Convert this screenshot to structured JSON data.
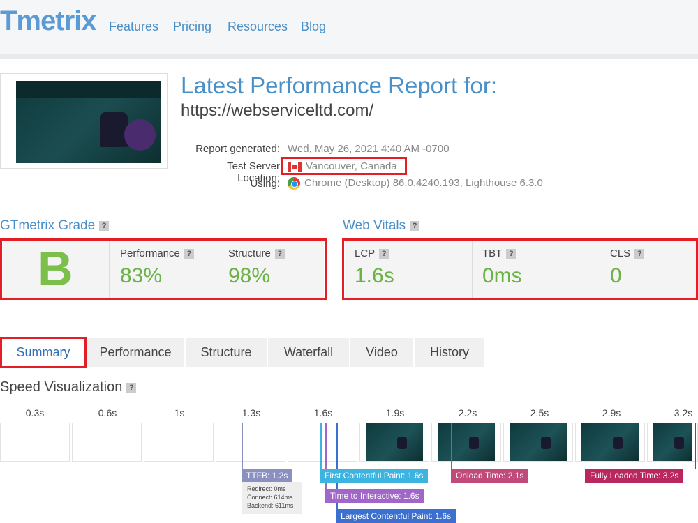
{
  "nav": {
    "logo": "Tmetrix",
    "links": [
      "Features",
      "Pricing",
      "Resources",
      "Blog"
    ]
  },
  "report": {
    "title": "Latest Performance Report for:",
    "url": "https://webserviceltd.com/",
    "generated_label": "Report generated:",
    "generated_value": "Wed, May 26, 2021 4:40 AM -0700",
    "server_label": "Test Server Location:",
    "server_value": "Vancouver, Canada",
    "using_label": "Using:",
    "using_value": "Chrome (Desktop) 86.0.4240.193, Lighthouse 6.3.0"
  },
  "grade": {
    "title": "GTmetrix Grade",
    "letter": "B",
    "performance_label": "Performance",
    "performance_value": "83%",
    "structure_label": "Structure",
    "structure_value": "98%"
  },
  "vitals": {
    "title": "Web Vitals",
    "lcp_label": "LCP",
    "lcp_value": "1.6s",
    "tbt_label": "TBT",
    "tbt_value": "0ms",
    "cls_label": "CLS",
    "cls_value": "0"
  },
  "tabs": [
    "Summary",
    "Performance",
    "Structure",
    "Waterfall",
    "Video",
    "History"
  ],
  "speed": {
    "title": "Speed Visualization",
    "ticks": [
      "0.3s",
      "0.6s",
      "1s",
      "1.3s",
      "1.6s",
      "1.9s",
      "2.2s",
      "2.5s",
      "2.9s",
      "3.2s"
    ],
    "markers": {
      "ttfb": "TTFB: 1.2s",
      "redirect": "Redirect: 0ms",
      "connect": "Connect: 614ms",
      "backend": "Backend: 611ms",
      "fcp": "First Contentful Paint: 1.6s",
      "tti": "Time to Interactive: 1.6s",
      "lcp": "Largest Contentful Paint: 1.6s",
      "onload": "Onload Time: 2.1s",
      "fully_loaded": "Fully Loaded Time: 3.2s"
    }
  },
  "colors": {
    "accent": "#4a90c8",
    "grade_green": "#7cc04b",
    "highlight_red": "#e21f26",
    "ttfb": "#8a90c0",
    "fcp": "#3db4e0",
    "tti": "#a066c8",
    "lcp": "#3b6fd0",
    "onload": "#c04a7a",
    "fully_loaded": "#b8285e"
  },
  "icons": {
    "flag": "canada-flag-icon",
    "browser": "chrome-icon",
    "help": "question-mark-icon"
  }
}
